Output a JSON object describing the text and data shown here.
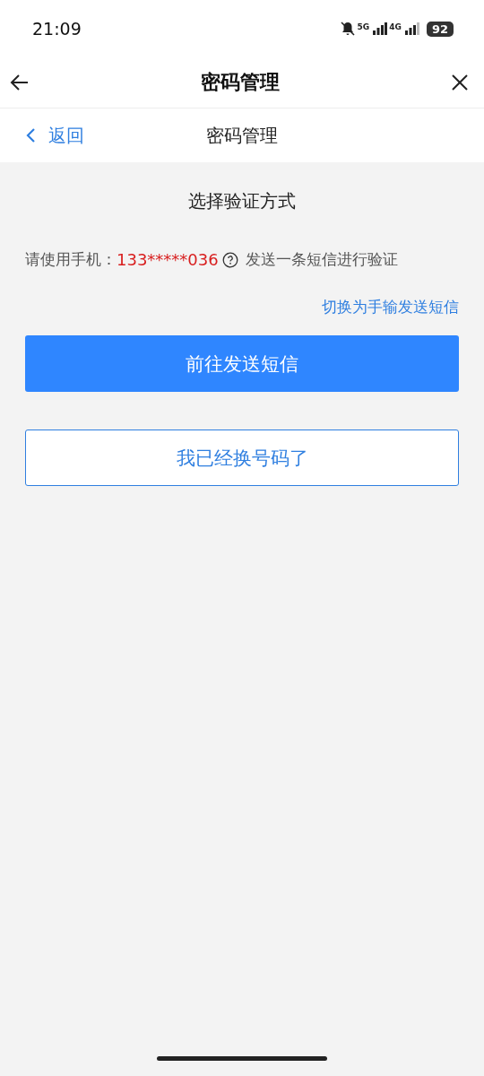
{
  "status_bar": {
    "time": "21:09",
    "network_1": "5G",
    "network_2": "4G",
    "battery": "92"
  },
  "title_bar": {
    "title": "密码管理"
  },
  "nav_bar": {
    "back": "返回",
    "title": "密码管理"
  },
  "content": {
    "heading": "选择验证方式",
    "prompt": {
      "prefix": "请使用手机：",
      "phone": "133*****036",
      "suffix": "发送一条短信进行验证"
    },
    "switch_link": "切换为手输发送短信",
    "primary_button": "前往发送短信",
    "secondary_button": "我已经换号码了"
  }
}
